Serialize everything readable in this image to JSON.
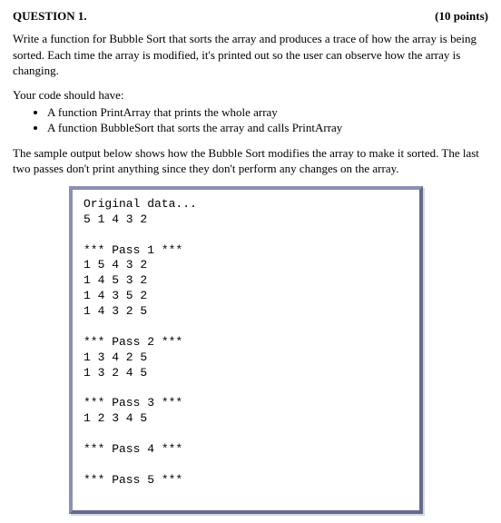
{
  "header": {
    "title": "QUESTION 1.",
    "points": "(10 points)"
  },
  "intro": "Write a function for Bubble Sort that sorts the array and produces a trace of how the array is being sorted. Each time the array is modified, it's printed out so the user can observe how the array is changing.",
  "requirements_intro": "Your code should have:",
  "requirements": [
    "A function PrintArray that prints the whole array",
    "A function BubbleSort that sorts the array and calls PrintArray"
  ],
  "sample_intro": "The sample output below shows how the Bubble Sort modifies the array to make it sorted. The last two passes don't print anything since they don't perform any changes on the array.",
  "output_lines": [
    "Original data...",
    "5 1 4 3 2",
    "",
    "*** Pass 1 ***",
    "1 5 4 3 2",
    "1 4 5 3 2",
    "1 4 3 5 2",
    "1 4 3 2 5",
    "",
    "*** Pass 2 ***",
    "1 3 4 2 5",
    "1 3 2 4 5",
    "",
    "*** Pass 3 ***",
    "1 2 3 4 5",
    "",
    "*** Pass 4 ***",
    "",
    "*** Pass 5 ***"
  ],
  "chart_data": {
    "type": "table",
    "title": "Bubble Sort trace",
    "initial_array": [
      5,
      1,
      4,
      3,
      2
    ],
    "passes": [
      {
        "pass": 1,
        "states": [
          [
            1,
            5,
            4,
            3,
            2
          ],
          [
            1,
            4,
            5,
            3,
            2
          ],
          [
            1,
            4,
            3,
            5,
            2
          ],
          [
            1,
            4,
            3,
            2,
            5
          ]
        ]
      },
      {
        "pass": 2,
        "states": [
          [
            1,
            3,
            4,
            2,
            5
          ],
          [
            1,
            3,
            2,
            4,
            5
          ]
        ]
      },
      {
        "pass": 3,
        "states": [
          [
            1,
            2,
            3,
            4,
            5
          ]
        ]
      },
      {
        "pass": 4,
        "states": []
      },
      {
        "pass": 5,
        "states": []
      }
    ],
    "sorted_array": [
      1,
      2,
      3,
      4,
      5
    ]
  }
}
